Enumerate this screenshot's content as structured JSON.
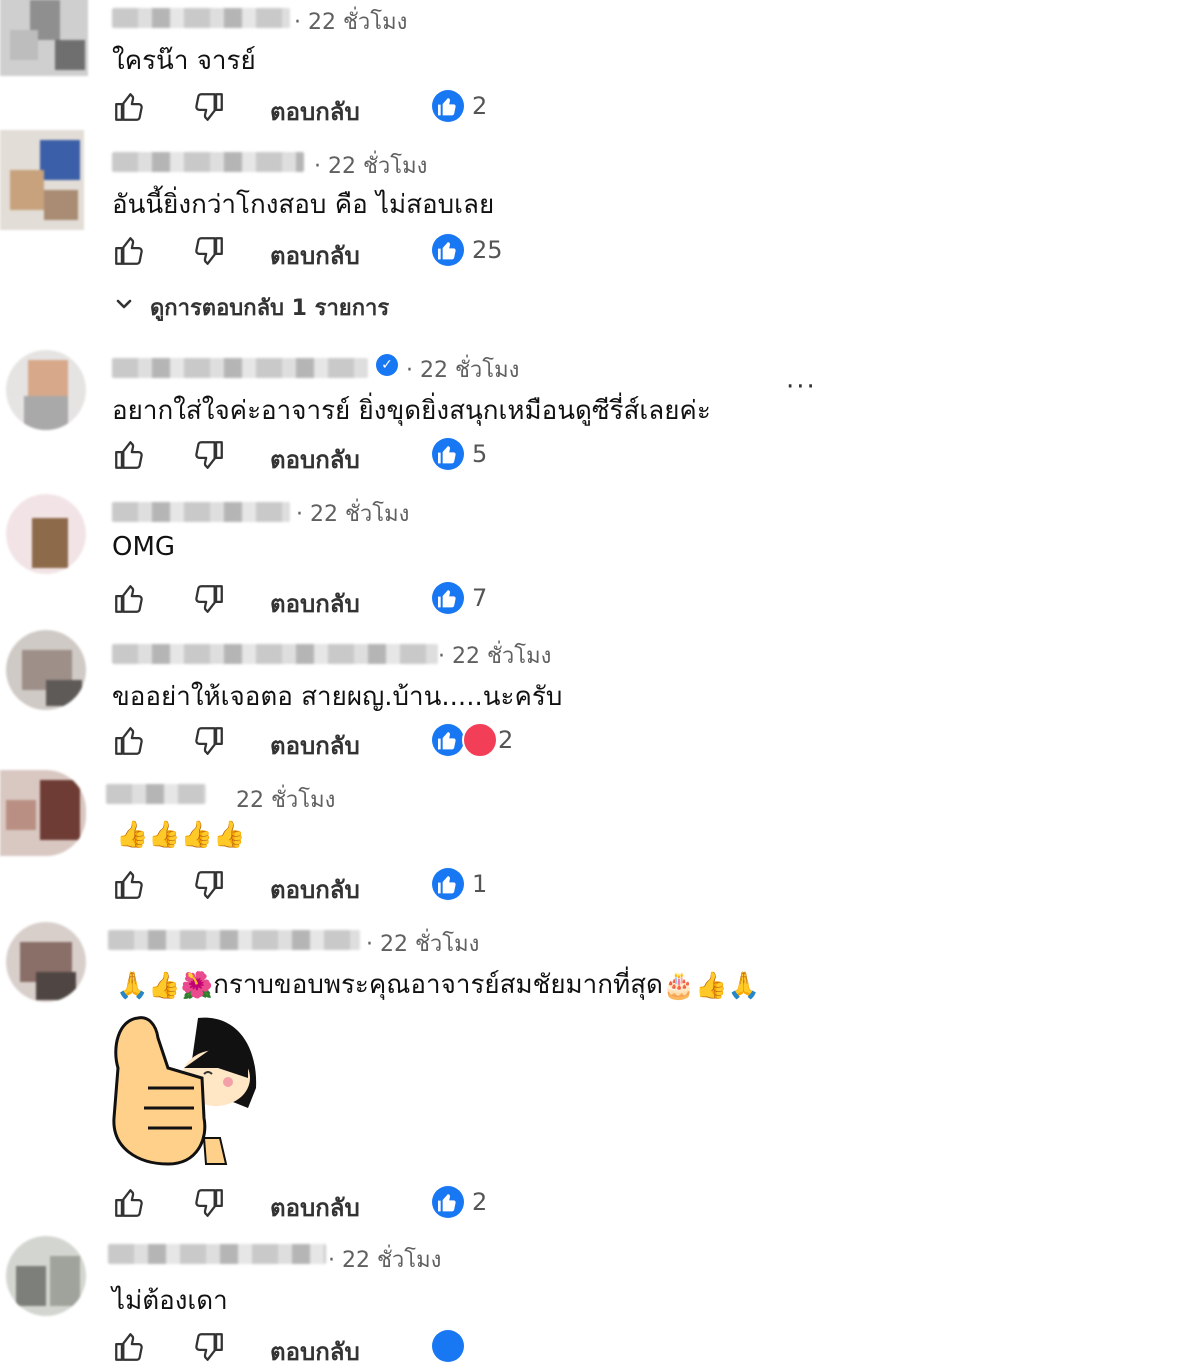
{
  "colors": {
    "accent": "#1877f2",
    "heart": "#f33e58",
    "muted": "#606060"
  },
  "action_labels": {
    "reply": "ตอบกลับ"
  },
  "comments": [
    {
      "time": "· 22 ชั่วโมง",
      "text": "ใครน๊า จารย์",
      "reaction_count": "2"
    },
    {
      "time": "· 22 ชั่วโมง",
      "text": "อันนี้ยิ่งกว่าโกงสอบ คือ ไม่สอบเลย",
      "reaction_count": "25"
    },
    {
      "time": "· 22 ชั่วโมง",
      "text": "อยากใส่ใจค่ะอาจารย์ ยิ่งขุดยิ่งสนุกเหมือนดูซีรี่ส์เลยค่ะ",
      "reaction_count": "5"
    },
    {
      "time": "· 22 ชั่วโมง",
      "text": "OMG",
      "reaction_count": "7"
    },
    {
      "time": "· 22 ชั่วโมง",
      "text": "ขออย่าให้เจอตอ สายผญ.บ้าน.....นะครับ",
      "reaction_count": "2"
    },
    {
      "time": "22 ชั่วโมง",
      "text": "👍👍👍👍",
      "reaction_count": "1"
    },
    {
      "time": "· 22 ชั่วโมง",
      "text": "กราบขอบพระคุณอาจารย์สมชัยมากที่สุด",
      "reaction_count": "2"
    },
    {
      "time": "· 22 ชั่วโมง",
      "text": "ไม่ต้องเดา"
    }
  ],
  "view_replies": "ดูการตอบกลับ 1 รายการ",
  "more_label": "···"
}
